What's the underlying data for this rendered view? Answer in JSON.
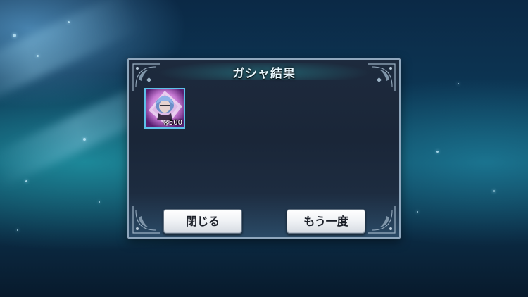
{
  "dialog": {
    "title": "ガシャ結果",
    "items": [
      {
        "quantity_label": "×500",
        "art": "blue-haired-character-crystal"
      }
    ],
    "buttons": {
      "close_label": "閉じる",
      "again_label": "もう一度"
    }
  },
  "colors": {
    "tile_border": "#5ec0e8",
    "title_text": "#e8f8ff",
    "button_text": "#1b1f28"
  }
}
